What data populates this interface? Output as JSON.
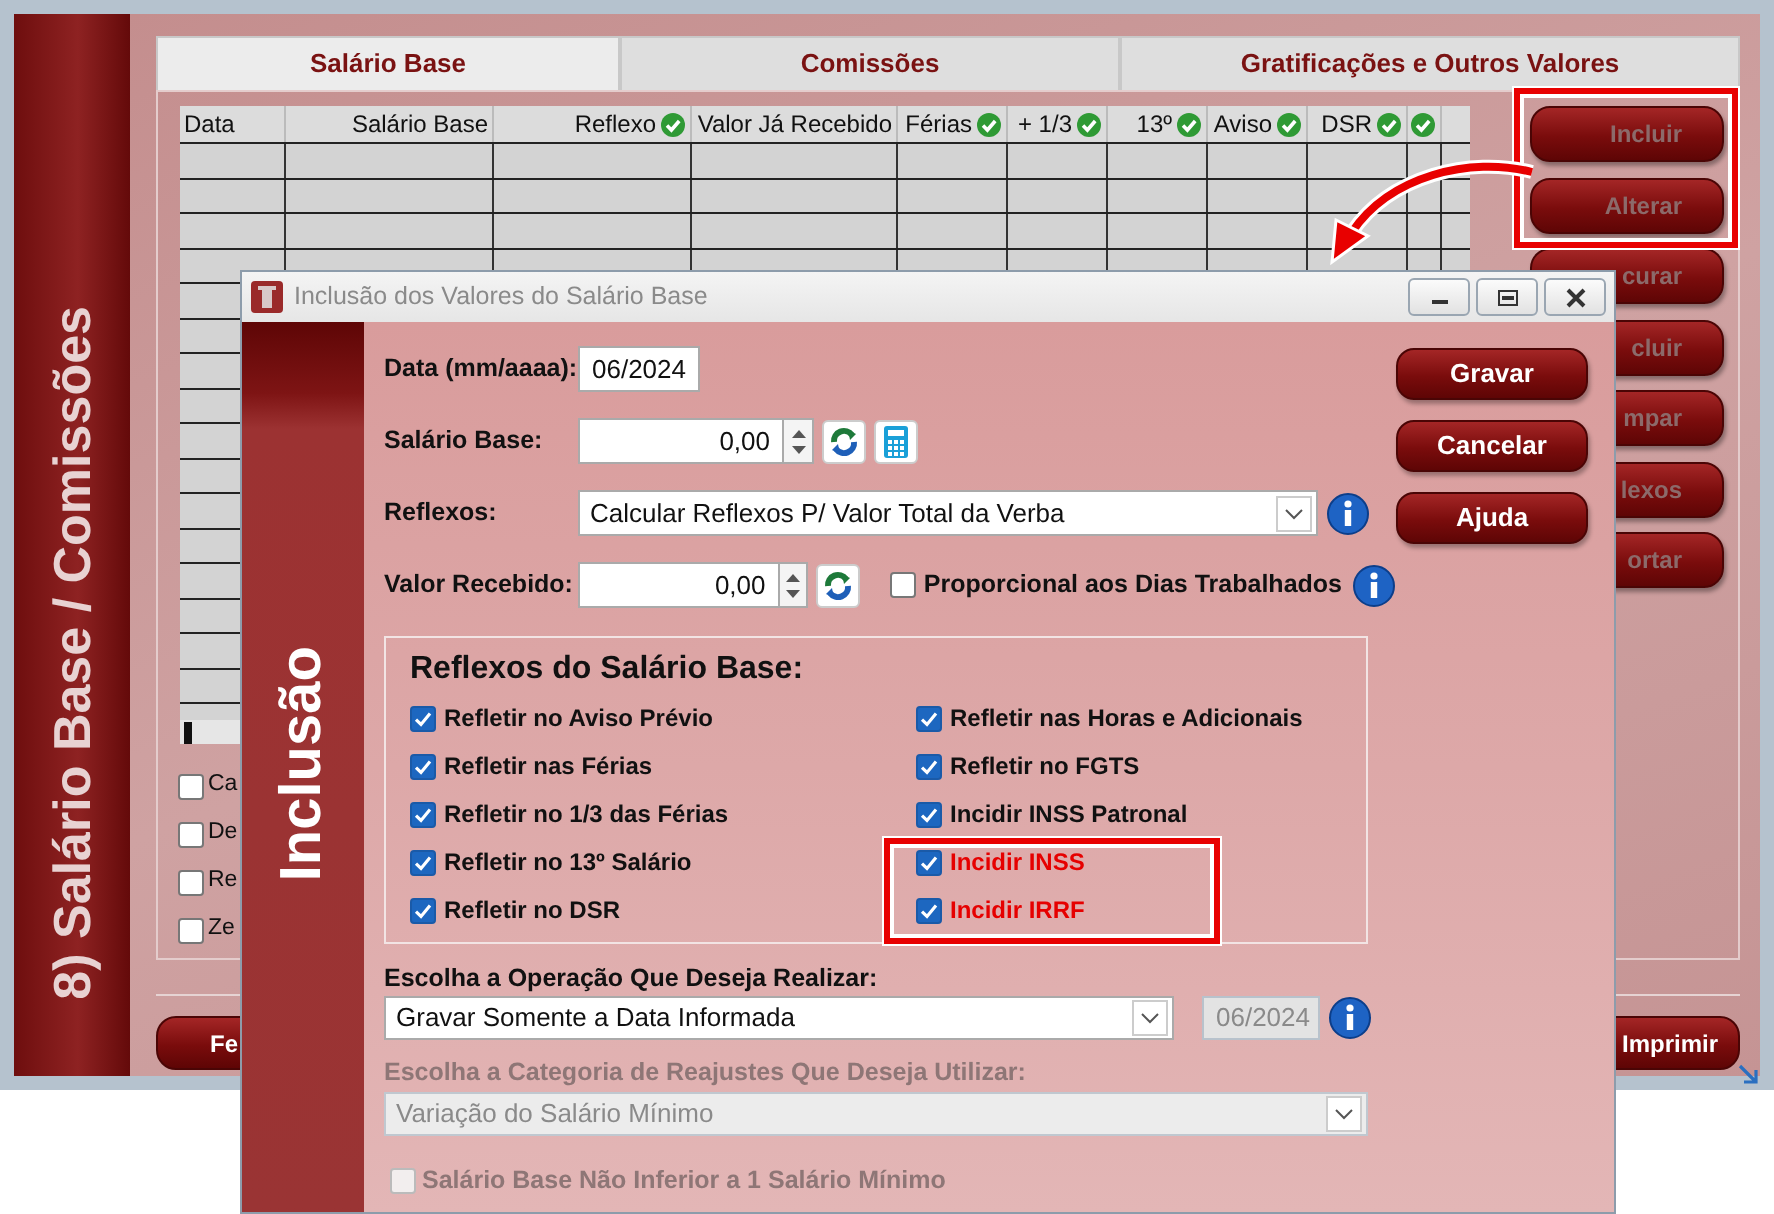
{
  "main_window": {
    "side_title": "8) Salário Base / Comissões",
    "tabs": [
      {
        "label": "Salário Base",
        "selected": true
      },
      {
        "label": "Comissões",
        "selected": false
      },
      {
        "label": "Gratificações e Outros Valores",
        "selected": false
      }
    ],
    "table": {
      "columns": [
        {
          "label": "Data",
          "check": false
        },
        {
          "label": "Salário Base",
          "check": false
        },
        {
          "label": "Reflexo",
          "check": true
        },
        {
          "label": "Valor Já Recebido",
          "check": false
        },
        {
          "label": "Férias",
          "check": true
        },
        {
          "label": "+ 1/3",
          "check": true
        },
        {
          "label": "13º",
          "check": true
        },
        {
          "label": "Aviso",
          "check": true
        },
        {
          "label": "DSR",
          "check": true
        },
        {
          "check": true
        }
      ]
    },
    "buttons": [
      {
        "label": "Incluir",
        "disabled": true
      },
      {
        "label": "Alterar",
        "disabled": true
      },
      {
        "label": "curar",
        "disabled": true
      },
      {
        "label": "cluir",
        "disabled": true
      },
      {
        "label": "mpar",
        "disabled": true
      },
      {
        "label": "lexos",
        "disabled": true
      },
      {
        "label": "ortar",
        "disabled": true
      }
    ],
    "options": [
      {
        "label": "Ca",
        "checked": false
      },
      {
        "label": "De",
        "checked": false
      },
      {
        "label": "Re",
        "checked": false
      },
      {
        "label": "Ze",
        "checked": false
      }
    ],
    "footer_buttons": [
      {
        "label": "Fe"
      },
      {
        "label": "Imprimir"
      }
    ]
  },
  "dialog": {
    "title": "Inclusão dos Valores do Salário Base",
    "side_title": "Inclusão",
    "fields": [
      {
        "kind": "text",
        "label": "Data (mm/aaaa):",
        "value": "06/2024"
      },
      {
        "kind": "number",
        "label": "Salário Base:",
        "value": "0,00",
        "calculator": true
      },
      {
        "kind": "select",
        "label": "Reflexos:",
        "value": "Calcular Reflexos P/ Valor Total da Verba"
      },
      {
        "kind": "number",
        "label": "Valor Recebido:",
        "value": "0,00",
        "calculator": false,
        "option": {
          "label": "Proporcional aos Dias Trabalhados",
          "checked": false
        }
      }
    ],
    "buttons": [
      {
        "label": "Gravar"
      },
      {
        "label": "Cancelar"
      },
      {
        "label": "Ajuda"
      }
    ],
    "group": {
      "title": "Reflexos do Salário Base:",
      "columns": [
        {
          "items": [
            {
              "label": "Refletir no Aviso Prévio",
              "checked": true,
              "highlighted": false
            },
            {
              "label": "Refletir nas Férias",
              "checked": true,
              "highlighted": false
            },
            {
              "label": "Refletir no 1/3 das Férias",
              "checked": true,
              "highlighted": false
            },
            {
              "label": "Refletir no 13º Salário",
              "checked": true,
              "highlighted": false
            },
            {
              "label": "Refletir no DSR",
              "checked": true,
              "highlighted": false
            }
          ]
        },
        {
          "items": [
            {
              "label": "Refletir nas Horas e Adicionais",
              "checked": true,
              "highlighted": false
            },
            {
              "label": "Refletir no FGTS",
              "checked": true,
              "highlighted": false
            },
            {
              "label": "Incidir INSS Patronal",
              "checked": true,
              "highlighted": false
            },
            {
              "label": "Incidir INSS",
              "checked": true,
              "highlighted": true
            },
            {
              "label": "Incidir IRRF",
              "checked": true,
              "highlighted": true
            }
          ]
        }
      ]
    },
    "operation": {
      "label": "Escolha a Operação Que Deseja Realizar:",
      "value": "Gravar Somente a Data Informada",
      "date": "06/2024",
      "date_disabled": true
    },
    "category": {
      "label": "Escolha a Categoria de Reajustes Que Deseja Utilizar:",
      "value": "Variação do Salário Mínimo",
      "disabled": true
    },
    "minimum": {
      "label": "Salário Base Não Inferior a 1 Salário Mínimo",
      "checked": false,
      "disabled": true
    }
  }
}
